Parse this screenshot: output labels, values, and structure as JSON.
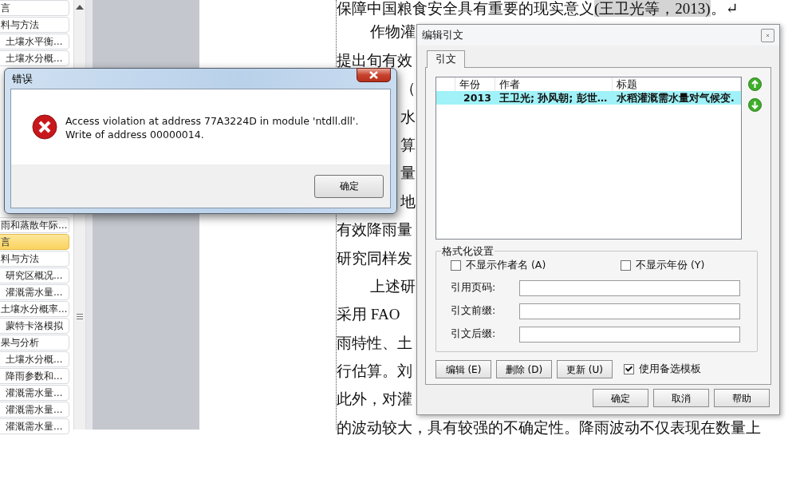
{
  "navigation_pane": {
    "sections": [
      {
        "items": [
          {
            "label": "言",
            "selected": false
          },
          {
            "label": "料与方法",
            "selected": false,
            "children": [
              {
                "label": "土壤水平衡…",
                "selected": false
              },
              {
                "label": "土壤水分概…",
                "selected": false
              }
            ]
          }
        ]
      },
      {
        "items": [
          {
            "label": "雨和蒸散年际…",
            "selected": false
          },
          {
            "label": "言",
            "selected": true
          },
          {
            "label": "料与方法",
            "selected": false,
            "children": [
              {
                "label": "研究区概况…",
                "selected": false
              },
              {
                "label": "灌溉需水量…",
                "selected": false
              }
            ]
          },
          {
            "label": "土壤水分概率…",
            "selected": false,
            "children": [
              {
                "label": "蒙特卡洛模拟",
                "selected": false
              }
            ]
          },
          {
            "label": "果与分析",
            "selected": false,
            "children": [
              {
                "label": "土壤水分概…",
                "selected": false
              },
              {
                "label": "降雨参数和…",
                "selected": false
              },
              {
                "label": "灌溉需水量…",
                "selected": false
              },
              {
                "label": "灌溉需水量…",
                "selected": false
              },
              {
                "label": "灌溉需水量…",
                "selected": false
              }
            ]
          }
        ]
      }
    ]
  },
  "document": {
    "lines": [
      {
        "kind": "cited",
        "text": "保障中国粮食安全具有重要的现实意义",
        "citation": "(王卫光等，2013)",
        "tail": "。↵"
      },
      {
        "kind": "indent",
        "text": "作物灌"
      },
      {
        "kind": "plain",
        "text": "提出旬有效"
      },
      {
        "kind": "covered",
        "text": "（"
      },
      {
        "kind": "covered",
        "text": "水"
      },
      {
        "kind": "covered",
        "text": "算"
      },
      {
        "kind": "covered",
        "text": "量"
      },
      {
        "kind": "covered",
        "text": "地"
      },
      {
        "kind": "plain",
        "text": "有效降雨量"
      },
      {
        "kind": "plain",
        "text": "研究同样发"
      },
      {
        "kind": "indent",
        "text": "上述研"
      },
      {
        "kind": "plain",
        "text": "采用 FAO"
      },
      {
        "kind": "plain",
        "text": "雨特性、土"
      },
      {
        "kind": "plain",
        "text": "行估算。刘"
      },
      {
        "kind": "plain",
        "text": "此外，对灌"
      },
      {
        "kind": "plain",
        "text": "的波动较大，具有较强的不确定性。降雨波动不仅表现在数量上"
      }
    ]
  },
  "error_dialog": {
    "title": "错误",
    "message": "Access violation at address 77A3224D in module 'ntdll.dll'. Write of address 00000014.",
    "buttons": [
      "确定"
    ]
  },
  "citation_dialog": {
    "title": "编辑引文",
    "tabs": [
      {
        "label": "引文",
        "selected": true
      }
    ],
    "list": {
      "columns": [
        "年份",
        "作者",
        "标题"
      ],
      "rows": [
        {
          "year": "2013",
          "authors": "王卫光; 孙风朝; 彭世…",
          "title": "水稻灌溉需水量对气候变.",
          "selected": true
        }
      ]
    },
    "format_group": {
      "title": "格式化设置",
      "checkboxes": [
        {
          "label": "不显示作者名 (A)",
          "checked": false
        },
        {
          "label": "不显示年份 (Y)",
          "checked": false
        }
      ],
      "fields": [
        {
          "label": "引用页码:"
        },
        {
          "label": "引文前缀:"
        },
        {
          "label": "引文后缀:"
        }
      ]
    },
    "action_buttons": [
      "编辑 (E)",
      "删除 (D)",
      "更新 (U)"
    ],
    "alternate_template": {
      "label": "使用备选模板",
      "checked": true
    },
    "buttons": [
      "确定",
      "取消",
      "帮助"
    ]
  }
}
